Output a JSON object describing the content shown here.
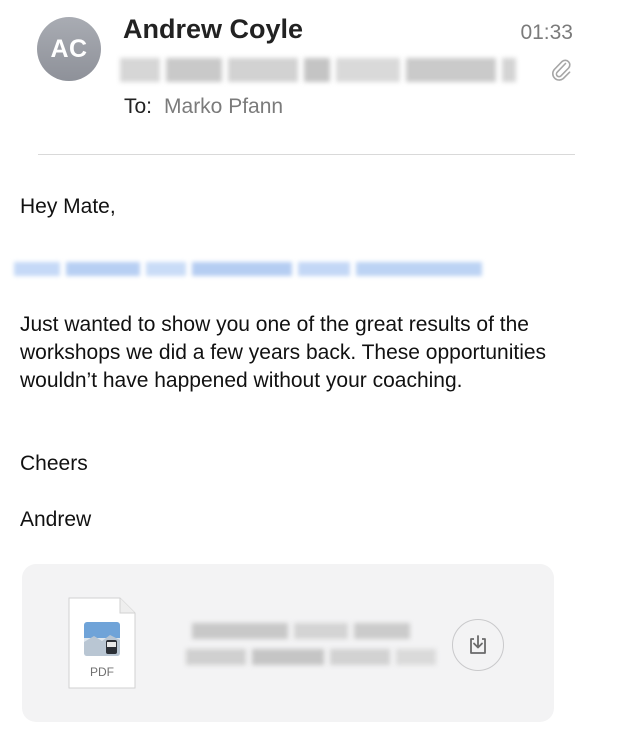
{
  "header": {
    "avatar_initials": "AC",
    "sender_name": "Andrew Coyle",
    "time": "01:33",
    "subject": "",
    "to_label": "To:",
    "to_name": "Marko Pfann"
  },
  "message": {
    "greeting": "Hey Mate,",
    "link_text": "",
    "paragraph": "Just wanted to show you one of the great results of the workshops we did a few years back. These opportunities wouldn’t have happened without your coaching.",
    "closing": "Cheers",
    "signature": "Andrew"
  },
  "attachment": {
    "type_label": "PDF",
    "filename": "",
    "icons": {
      "file": "pdf-file-icon",
      "download": "download-icon",
      "attachment": "paperclip-icon"
    }
  },
  "colors": {
    "avatar": "#9a9da4",
    "muted_text": "#7b7b7b",
    "link": "#4a90e2",
    "card_bg": "#f3f3f4"
  }
}
